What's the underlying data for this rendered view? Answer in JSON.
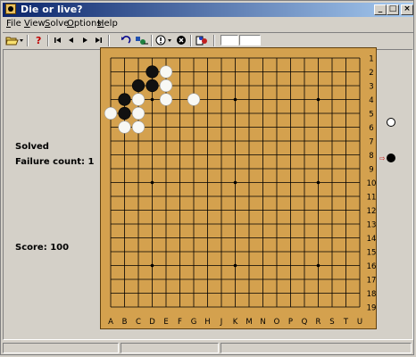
{
  "window": {
    "title": "Die or live?"
  },
  "menu": {
    "items": [
      {
        "label": "File",
        "accel": "F",
        "rest": "ile"
      },
      {
        "label": "View",
        "accel": "V",
        "rest": "iew"
      },
      {
        "label": "Solve",
        "accel": "S",
        "rest": "olve"
      },
      {
        "label": "Options",
        "accel": "O",
        "rest": "ptions"
      },
      {
        "label": "Help",
        "accel": "H",
        "rest": "elp"
      }
    ]
  },
  "title_buttons": {
    "minimize": "_",
    "maximize": "□",
    "close": "×"
  },
  "toolbar": {
    "open_icon": "folder-open-icon",
    "hint_icon": "question-mark-icon",
    "first_icon": "first-move-icon",
    "prev_icon": "previous-move-icon",
    "next_icon": "next-move-icon",
    "last_icon": "last-move-icon",
    "undo_icon": "undo-icon",
    "mode_icon": "mode-icon",
    "info_icon": "info-icon",
    "stop_icon": "stop-icon",
    "compare_icon": "compare-icon"
  },
  "info": {
    "status": "Solved",
    "failure": "Failure count: 1",
    "score": "Score: 100"
  },
  "board": {
    "size": 19,
    "col_labels": [
      "A",
      "B",
      "C",
      "D",
      "E",
      "F",
      "G",
      "H",
      "J",
      "K",
      "M",
      "N",
      "O",
      "P",
      "Q",
      "R",
      "S",
      "T",
      "U"
    ],
    "row_labels": [
      "1",
      "2",
      "3",
      "4",
      "5",
      "6",
      "7",
      "8",
      "9",
      "10",
      "11",
      "12",
      "13",
      "14",
      "15",
      "16",
      "17",
      "18",
      "19"
    ],
    "hoshi": [
      [
        3,
        3
      ],
      [
        9,
        3
      ],
      [
        15,
        3
      ],
      [
        3,
        9
      ],
      [
        9,
        9
      ],
      [
        15,
        9
      ],
      [
        3,
        15
      ],
      [
        9,
        15
      ],
      [
        15,
        15
      ]
    ],
    "stones": [
      {
        "col": 3,
        "row": 1,
        "color": "black"
      },
      {
        "col": 4,
        "row": 1,
        "color": "white"
      },
      {
        "col": 2,
        "row": 2,
        "color": "black"
      },
      {
        "col": 3,
        "row": 2,
        "color": "black"
      },
      {
        "col": 4,
        "row": 2,
        "color": "white"
      },
      {
        "col": 1,
        "row": 3,
        "color": "black"
      },
      {
        "col": 2,
        "row": 3,
        "color": "white"
      },
      {
        "col": 4,
        "row": 3,
        "color": "white"
      },
      {
        "col": 6,
        "row": 3,
        "color": "white"
      },
      {
        "col": 0,
        "row": 4,
        "color": "white"
      },
      {
        "col": 1,
        "row": 4,
        "color": "black"
      },
      {
        "col": 2,
        "row": 4,
        "color": "white"
      },
      {
        "col": 1,
        "row": 5,
        "color": "white"
      },
      {
        "col": 2,
        "row": 5,
        "color": "white"
      }
    ]
  },
  "turn": {
    "white_label": "white-stone-indicator",
    "black_label": "black-stone-indicator",
    "current": "black",
    "arrow": "⇨"
  },
  "colors": {
    "board": "#d4a14e",
    "title_start": "#0a246a",
    "title_end": "#a6caf0"
  }
}
